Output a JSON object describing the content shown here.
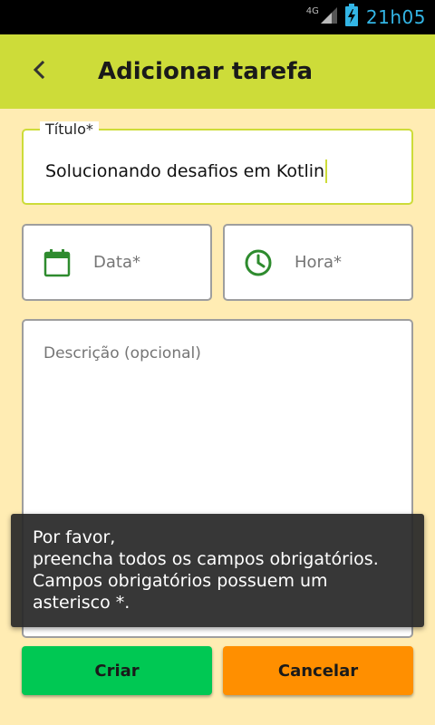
{
  "status_bar": {
    "network_type": "4G",
    "time": "21h05",
    "icons": [
      "signal-icon",
      "battery-charging-icon"
    ]
  },
  "app_bar": {
    "back_icon": "chevron-left-icon",
    "title": "Adicionar tarefa"
  },
  "form": {
    "title_field": {
      "label": "Título*",
      "value": "Solucionando desafios em Kotlin"
    },
    "date_field": {
      "icon": "calendar-icon",
      "placeholder": "Data*"
    },
    "time_field": {
      "icon": "clock-icon",
      "placeholder": "Hora*"
    },
    "description_field": {
      "placeholder": "Descrição (opcional)"
    }
  },
  "actions": {
    "create_label": "Criar",
    "cancel_label": "Cancelar"
  },
  "toast": {
    "lines": [
      "Por favor,",
      "preencha todos os campos obrigatórios.",
      "Campos obrigatórios possuem um",
      "asterisco *."
    ]
  },
  "colors": {
    "app_bar": "#cddc39",
    "background": "#ffecb3",
    "accent_green": "#00c853",
    "accent_orange": "#ff8f00",
    "icon_green": "#2e8b2e",
    "status_time": "#33b5e5"
  }
}
